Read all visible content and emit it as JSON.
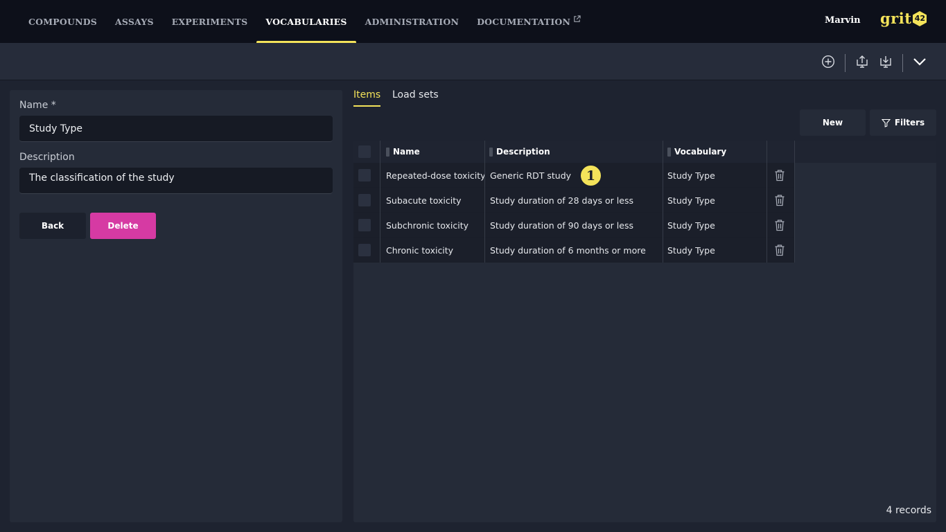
{
  "nav": {
    "items": [
      "COMPOUNDS",
      "ASSAYS",
      "EXPERIMENTS",
      "VOCABULARIES",
      "ADMINISTRATION",
      "DOCUMENTATION"
    ],
    "active": "VOCABULARIES",
    "user": "Marvin",
    "logo_text": "grit",
    "logo_number": "42"
  },
  "toolbar": {
    "icons": [
      "add-circle-icon",
      "upload-icon",
      "download-icon",
      "chevron-down-icon"
    ]
  },
  "form": {
    "name_label": "Name *",
    "name_value": "Study Type",
    "description_label": "Description",
    "description_value": "The classification of the study",
    "back_label": "Back",
    "delete_label": "Delete"
  },
  "tabs": [
    "Items",
    "Load sets"
  ],
  "actions": {
    "new_label": "New",
    "filters_label": "Filters"
  },
  "table": {
    "columns": [
      "Name",
      "Description",
      "Vocabulary"
    ],
    "rows": [
      {
        "name": "Repeated-dose toxicity",
        "description": "Generic RDT study",
        "vocabulary": "Study Type"
      },
      {
        "name": "Subacute toxicity",
        "description": "Study duration of 28 days or less",
        "vocabulary": "Study Type"
      },
      {
        "name": "Subchronic toxicity",
        "description": "Study duration of 90 days or less",
        "vocabulary": "Study Type"
      },
      {
        "name": "Chronic toxicity",
        "description": "Study duration of 6 months or more",
        "vocabulary": "Study Type"
      }
    ],
    "records": "4 records"
  },
  "annotation": "1",
  "colors": {
    "accent": "#f4e35a",
    "delete": "#d63aa3",
    "background": "#1e2330",
    "topbar": "#0d101a"
  }
}
